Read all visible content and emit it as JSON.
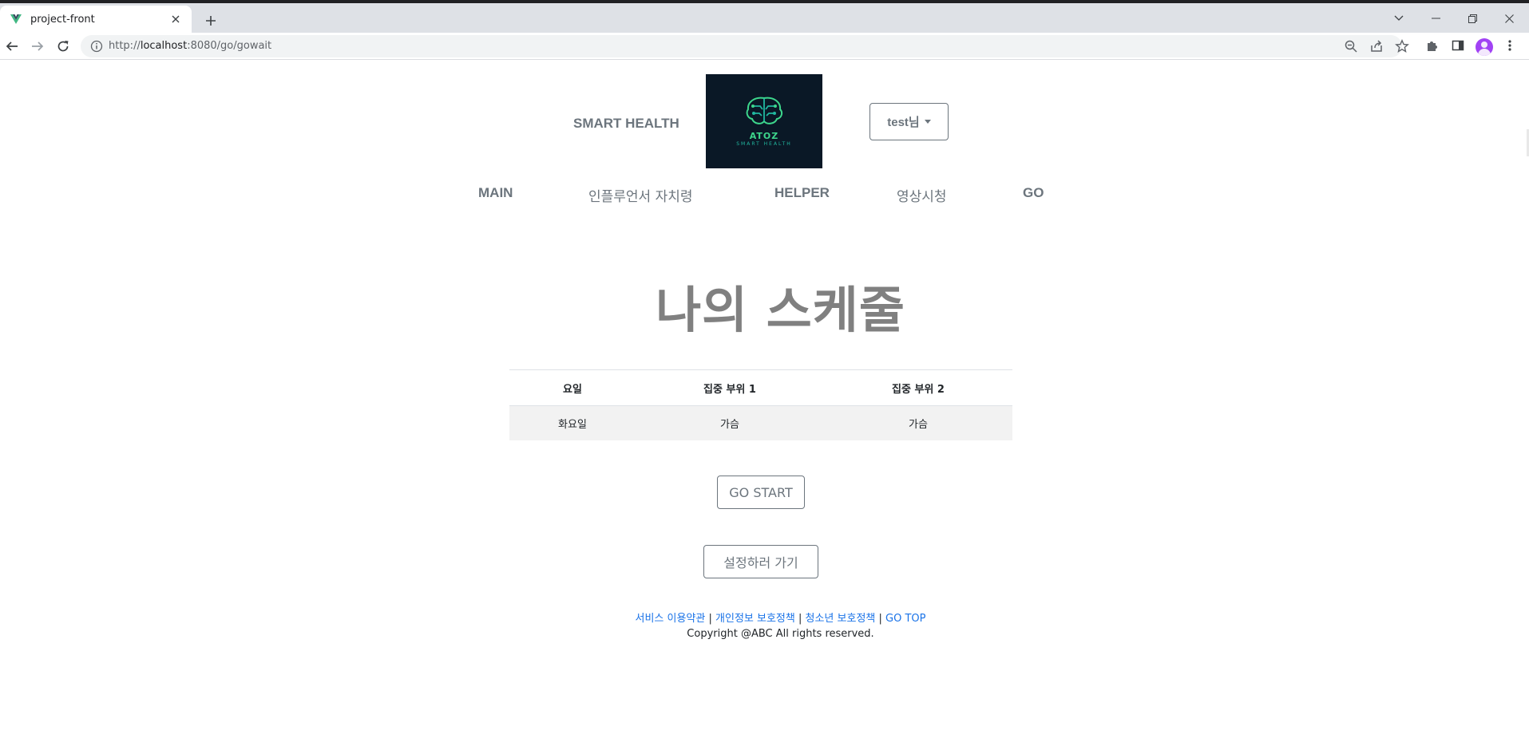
{
  "browser": {
    "tab_title": "project-front",
    "url_prefix": "http://",
    "url_host": "localhost",
    "url_path": ":8080/go/gowait"
  },
  "header": {
    "brand": "SMART HEALTH",
    "logo_main": "ATOZ",
    "logo_sub": "SMART HEALTH",
    "user_label": "test님"
  },
  "menu": [
    "MAIN",
    "인플루언서 자치령",
    "HELPER",
    "영상시청",
    "GO"
  ],
  "main": {
    "title": "나의 스케줄",
    "table": {
      "headers": [
        "요일",
        "집중 부위 1",
        "집중 부위 2"
      ],
      "rows": [
        [
          "화요일",
          "가슴",
          "가슴"
        ]
      ]
    },
    "go_start_label": "GO START",
    "settings_label": "설정하러 가기"
  },
  "footer": {
    "links": [
      "서비스 이용약관",
      "개인정보 보호정책",
      "청소년 보호정책",
      "GO TOP"
    ],
    "separator": "|",
    "copyright": "Copyright @ABC All rights reserved."
  },
  "colors": {
    "text_muted": "#6c757d",
    "title_gray": "#808080",
    "link_blue": "#1a73e8",
    "logo_bg": "#0a1826",
    "logo_green": "#3dd68c",
    "row_bg": "#f2f2f2"
  },
  "icons": [
    "vue-favicon-icon",
    "close-icon",
    "plus-icon",
    "chevron-down-icon",
    "minimize-icon",
    "restore-icon",
    "back-arrow-icon",
    "forward-arrow-icon",
    "reload-icon",
    "info-icon",
    "zoom-icon",
    "share-icon",
    "star-icon",
    "puzzle-icon",
    "side-panel-icon",
    "kebab-menu-icon",
    "brain-icon"
  ]
}
